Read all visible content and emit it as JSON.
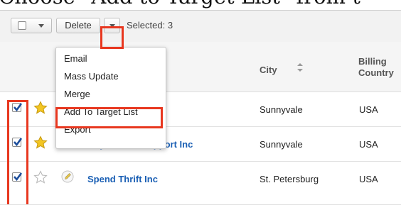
{
  "heading": "Choose \"Add to Target List\" from t",
  "toolbar": {
    "delete_label": "Delete",
    "selected_text": "Selected: 3"
  },
  "columns": {
    "city": "City",
    "billing_line1": "Billing",
    "billing_line2": "Country"
  },
  "menu": {
    "items": [
      "Email",
      "Mass Update",
      "Merge",
      "Add To Target List",
      "Export"
    ]
  },
  "rows": [
    {
      "name": "",
      "city": "Sunnyvale",
      "country": "USA",
      "checked": true,
      "favorite": true
    },
    {
      "name": "Anytime Air Support Inc",
      "city": "Sunnyvale",
      "country": "USA",
      "checked": true,
      "favorite": true
    },
    {
      "name": "Spend Thrift Inc",
      "city": "St. Petersburg",
      "country": "USA",
      "checked": true,
      "favorite": false
    }
  ],
  "colors": {
    "link": "#1a5fb4",
    "highlight": "#e8371f",
    "star": "#f3c623"
  }
}
